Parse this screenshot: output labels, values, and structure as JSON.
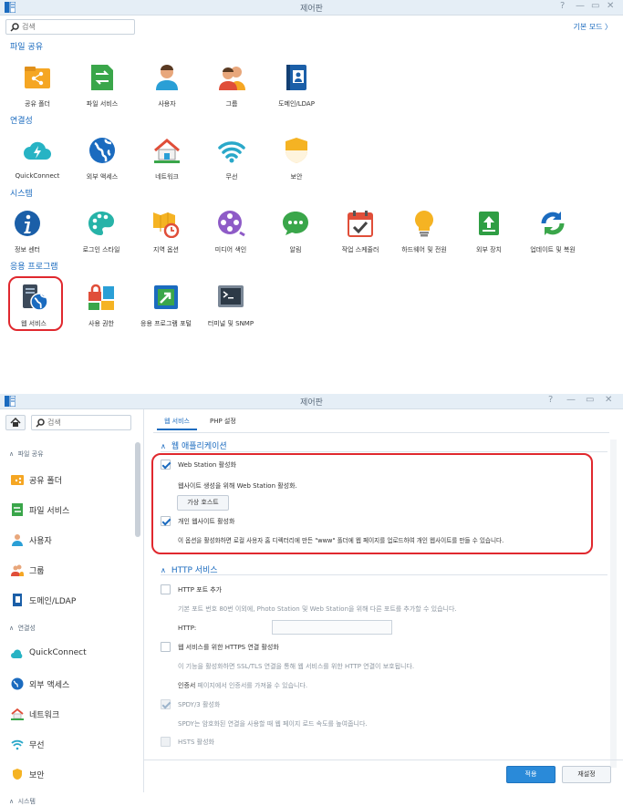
{
  "top_window": {
    "title": "제어판",
    "search_placeholder": "검색",
    "basic_mode": "기본 모드 〉",
    "sections": {
      "file_sharing": "파일 공유",
      "connectivity": "연결성",
      "system": "시스템",
      "applications": "응용 프로그램"
    },
    "tiles": {
      "shared_folder": "공유 폴더",
      "file_services": "파일 서비스",
      "user": "사용자",
      "group": "그룹",
      "domain_ldap": "도메인/LDAP",
      "quickconnect": "QuickConnect",
      "external_access": "외부 액세스",
      "network": "네트워크",
      "wireless": "무선",
      "security": "보안",
      "info_center": "정보 센터",
      "login_style": "로그인 스타일",
      "regional_options": "지역 옵션",
      "media_index": "미디어 색인",
      "notification": "알림",
      "task_scheduler": "작업 스케줄러",
      "hardware_power": "하드웨어 및 전원",
      "external_devices": "외부 장치",
      "update_restore": "업데이트 및 복원",
      "web_services": "웹 서비스",
      "privileges": "사용 권한",
      "app_portal": "응용 프로그램 포털",
      "terminal_snmp": "터미널 및 SNMP"
    }
  },
  "bottom_window": {
    "title": "제어판",
    "search_placeholder": "검색",
    "sidebar": {
      "group_file_sharing": "파일 공유",
      "shared_folder": "공유 폴더",
      "file_services": "파일 서비스",
      "user": "사용자",
      "group": "그룹",
      "domain_ldap": "도메인/LDAP",
      "group_connectivity": "연결성",
      "quickconnect": "QuickConnect",
      "external_access": "외부 액세스",
      "network": "네트워크",
      "wireless": "무선",
      "security": "보안",
      "group_system": "시스템"
    },
    "tabs": {
      "web_services": "웹 서비스",
      "php_settings": "PHP 설정"
    },
    "web_apps": {
      "header": "웹 애플리케이션",
      "enable_web_station": "Web Station 활성화",
      "enable_web_station_desc": "웹사이트 생성을 위해 Web Station 활성화.",
      "virtual_host": "가상 호스트",
      "enable_personal": "개인 웹사이트 활성화",
      "enable_personal_desc": "이 옵션을 활성화하면 로컬 사용자 홈 디렉터리에 만든 \"www\" 폴더에 웹 페이지를 업로드하여 개인 웹사이트를 만들 수 있습니다."
    },
    "http_services": {
      "header": "HTTP 서비스",
      "add_http_port": "HTTP 포트 추가",
      "add_http_port_desc": "기본 포트 번호 80번 이외에, Photo Station 및 Web Station을 위해 다른 포트를 추가할 수 있습니다.",
      "http_label": "HTTP:",
      "https_enable": "웹 서비스를 위한 HTTPS 연결 활성화",
      "https_desc": "이 기능을 활성화하면 SSL/TLS 연결을 통해 웹 서비스를 위한 HTTP 연결이 보호됩니다.",
      "cert_note_link": "인증서",
      "cert_note_rest": " 페이지에서 인증서를 가져올 수 있습니다.",
      "spdy": "SPDY/3 활성화",
      "spdy_desc": "SPDY는 암호화된 연결을 사용할 때 웹 페이지 로드 속도를 높여줍니다.",
      "hsts": "HSTS 활성화"
    },
    "apply": "적용",
    "reset": "재설정"
  },
  "colors": {
    "accent": "#1b6bbf",
    "highlight": "#e0282e"
  }
}
